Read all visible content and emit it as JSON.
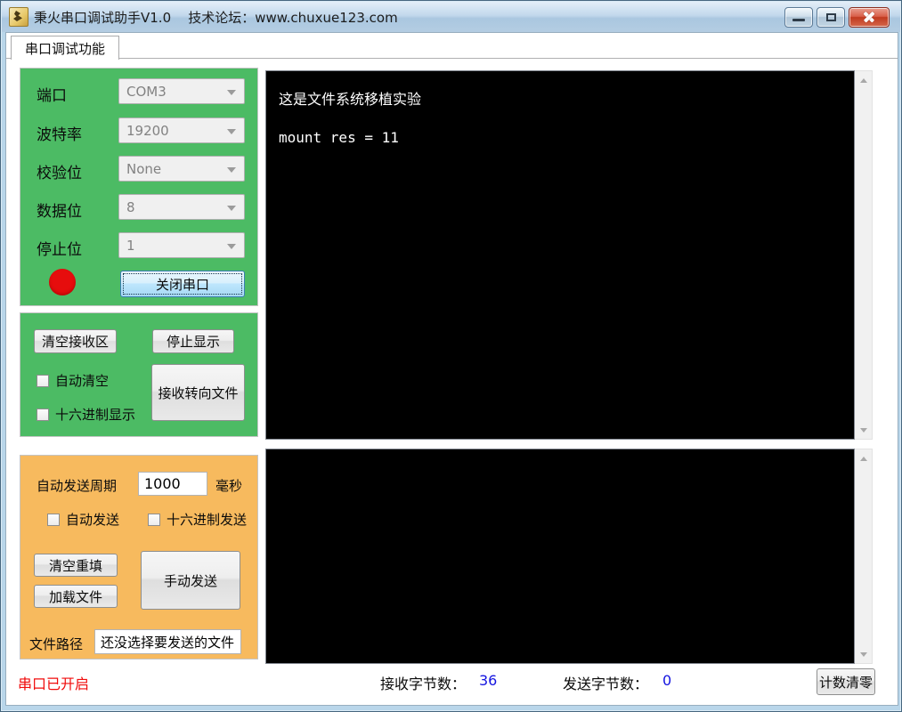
{
  "window": {
    "title": "秉火串口调试助手V1.0    技术论坛：www.chuxue123.com"
  },
  "tab": {
    "label": "串口调试功能"
  },
  "settings_panel": {
    "rows": [
      {
        "label": "端口",
        "value": "COM3"
      },
      {
        "label": "波特率",
        "value": "19200"
      },
      {
        "label": "校验位",
        "value": "None"
      },
      {
        "label": "数据位",
        "value": "8"
      },
      {
        "label": "停止位",
        "value": "1"
      }
    ],
    "close_serial_button": "关闭串口"
  },
  "receive_panel": {
    "clear_receive_button": "清空接收区",
    "stop_display_button": "停止显示",
    "auto_clear_label": "自动清空",
    "hex_display_label": "十六进制显示",
    "redirect_file_button": "接收转向文件"
  },
  "send_panel": {
    "period_label": "自动发送周期",
    "period_value": "1000",
    "period_unit": "毫秒",
    "auto_send_label": "自动发送",
    "hex_send_label": "十六进制发送",
    "clear_refill_button": "清空重填",
    "load_file_button": "加载文件",
    "manual_send_button": "手动发送",
    "file_path_label": "文件路径",
    "file_path_value": "还没选择要发送的文件"
  },
  "receive_area": {
    "line1": "这是文件系统移植实验",
    "line2": "mount res = 11"
  },
  "send_area": {
    "text": ""
  },
  "statusbar": {
    "port_status": "串口已开启",
    "recv_label": "接收字节数：",
    "recv_count": "36",
    "send_label": "发送字节数：",
    "send_count": "0",
    "reset_count_button": "计数清零"
  },
  "colors": {
    "panel_green": "#4cbb64",
    "panel_orange": "#f7ba5e",
    "status_red": "#f00c0c",
    "count_blue": "#1414e0",
    "indicator_red": "#e60d0d",
    "titlebar_blue": "#b4cde2"
  }
}
